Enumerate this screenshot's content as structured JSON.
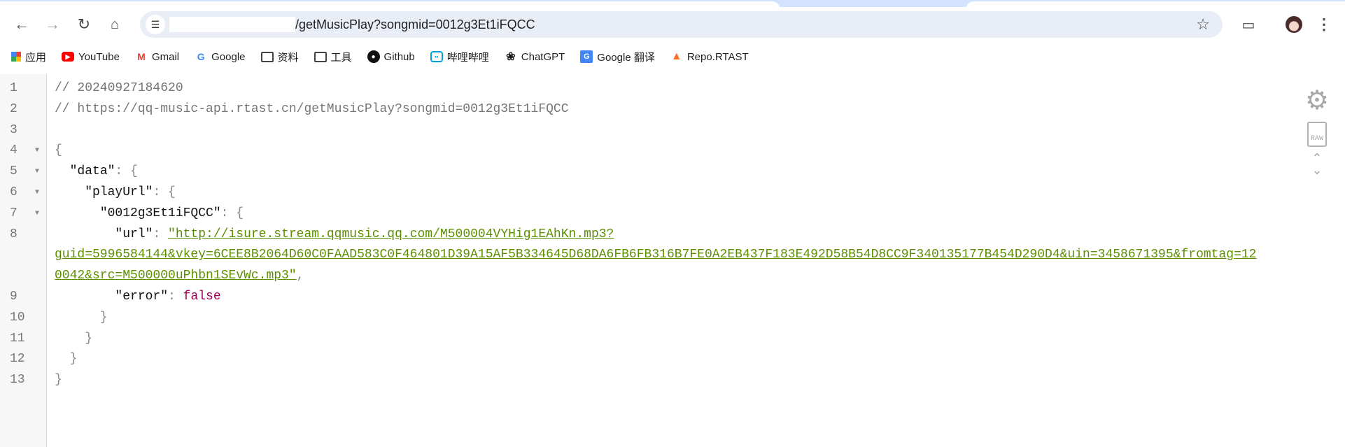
{
  "browser": {
    "address_bar": {
      "url_visible": "/getMusicPlay?songmid=0012g3Et1iFQCC"
    },
    "bookmarks": [
      {
        "label": "应用",
        "icon": "apps-grid-icon"
      },
      {
        "label": "YouTube",
        "icon": "youtube-icon"
      },
      {
        "label": "Gmail",
        "icon": "gmail-icon"
      },
      {
        "label": "Google",
        "icon": "google-icon"
      },
      {
        "label": "资料",
        "icon": "folder-icon"
      },
      {
        "label": "工具",
        "icon": "folder-icon"
      },
      {
        "label": "Github",
        "icon": "github-icon"
      },
      {
        "label": "哔哩哔哩",
        "icon": "bilibili-icon"
      },
      {
        "label": "ChatGPT",
        "icon": "chatgpt-icon"
      },
      {
        "label": "Google 翻译",
        "icon": "google-translate-icon"
      },
      {
        "label": "Repo.RTAST",
        "icon": "gitlab-icon"
      }
    ]
  },
  "viewer": {
    "line_numbers": [
      "1",
      "2",
      "3",
      "4",
      "5",
      "6",
      "7",
      "8",
      "9",
      "10",
      "11",
      "12",
      "13"
    ],
    "comment_timestamp": "// 20240927184620",
    "comment_url": "// https://qq-music-api.rtast.cn/getMusicPlay?songmid=0012g3Et1iFQCC",
    "key_data": "\"data\"",
    "key_playUrl": "\"playUrl\"",
    "key_songmid": "\"0012g3Et1iFQCC\"",
    "key_url": "\"url\"",
    "value_url": "\"http://isure.stream.qqmusic.qq.com/M500004VYHig1EAhKn.mp3?guid=5996584144&vkey=6CEE8B2064D60C0FAAD583C0F464801D39A15AF5B334645D68DA6FB6FB316B7FE0A2EB437F183E492D58B54D8CC9F340135177B454D290D4&uin=3458671395&fromtag=120042&src=M500000uPhbn1SEvWc.mp3\"",
    "key_error": "\"error\"",
    "value_error": "false",
    "colors": {
      "string": "#5c8f00",
      "boolean": "#990055",
      "comment": "#757575"
    },
    "side_tools": [
      "gear-icon",
      "raw-icon",
      "chevron-up-icon",
      "chevron-down-icon"
    ]
  }
}
